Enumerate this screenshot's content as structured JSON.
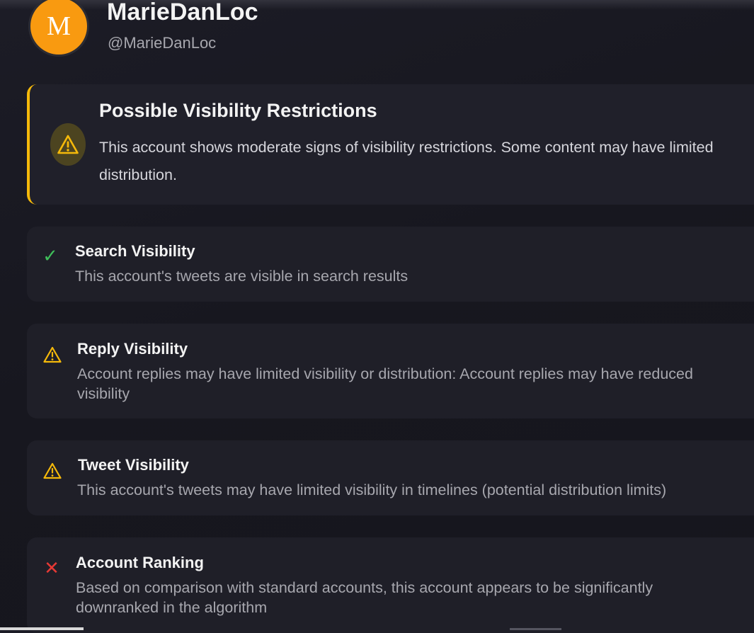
{
  "profile": {
    "avatar_initial": "M",
    "display_name": "MarieDanLoc",
    "handle": "@MarieDanLoc"
  },
  "alert": {
    "icon": "warning-icon",
    "title": "Possible Visibility Restrictions",
    "text": "This account shows moderate signs of visibility restrictions. Some content may have limited distribution."
  },
  "checks": [
    {
      "status": "ok",
      "icon": "check-icon",
      "title": "Search Visibility",
      "text": "This account's tweets are visible in search results"
    },
    {
      "status": "warning",
      "icon": "warning-icon",
      "title": "Reply Visibility",
      "text": "Account replies may have limited visibility or distribution: Account replies may have reduced visibility"
    },
    {
      "status": "warning",
      "icon": "warning-icon",
      "title": "Tweet Visibility",
      "text": "This account's tweets may have limited visibility in timelines (potential distribution limits)"
    },
    {
      "status": "fail",
      "icon": "cross-icon",
      "title": "Account Ranking",
      "text": "Based on comparison with standard accounts, this account appears to be significantly downranked in the algorithm"
    }
  ],
  "colors": {
    "background": "#17171f",
    "card": "#1f1f28",
    "avatar": "#f99a10",
    "warning": "#f5b90a",
    "ok": "#3fbf5a",
    "fail": "#e53935"
  }
}
